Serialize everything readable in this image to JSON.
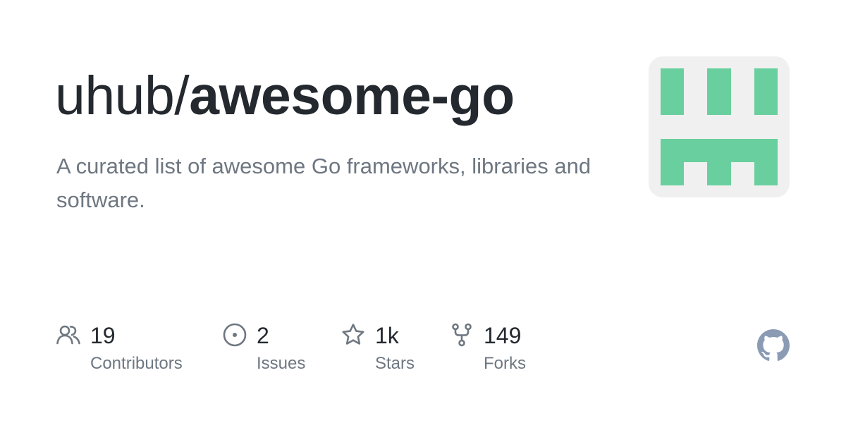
{
  "repo": {
    "owner": "uhub/",
    "name": "awesome-go",
    "description": "A curated list of awesome Go frameworks, libraries and software."
  },
  "stats": [
    {
      "icon": "contributors-icon",
      "count": "19",
      "label": "Contributors"
    },
    {
      "icon": "issues-icon",
      "count": "2",
      "label": "Issues"
    },
    {
      "icon": "star-icon",
      "count": "1k",
      "label": "Stars"
    },
    {
      "icon": "fork-icon",
      "count": "149",
      "label": "Forks"
    }
  ],
  "colors": {
    "title": "#24292f",
    "muted": "#6e7781",
    "avatar_bg": "#f0f0f0",
    "avatar_fg": "#69cf9e",
    "github_logo": "#8b9bb4"
  }
}
